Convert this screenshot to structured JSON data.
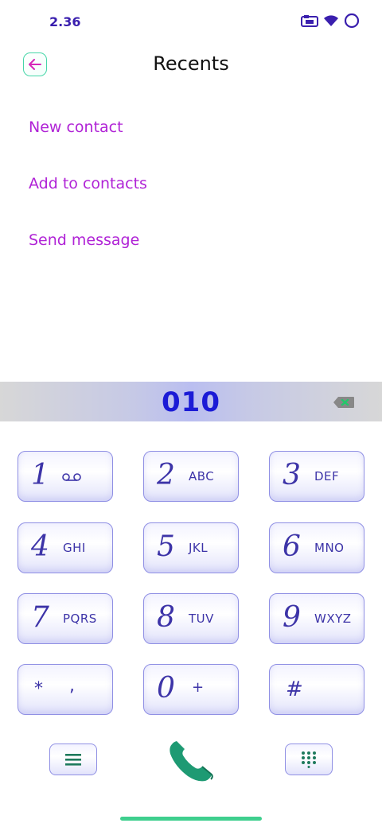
{
  "status": {
    "time": "2.36"
  },
  "header": {
    "title": "Recents"
  },
  "menu": {
    "items": [
      "New contact",
      "Add to contacts",
      "Send message"
    ]
  },
  "number": "010",
  "keypad": {
    "keys": [
      {
        "digit": "1",
        "letters": ""
      },
      {
        "digit": "2",
        "letters": "ABC"
      },
      {
        "digit": "3",
        "letters": "DEF"
      },
      {
        "digit": "4",
        "letters": "GHI"
      },
      {
        "digit": "5",
        "letters": "JKL"
      },
      {
        "digit": "6",
        "letters": "MNO"
      },
      {
        "digit": "7",
        "letters": "PQRS"
      },
      {
        "digit": "8",
        "letters": "TUV"
      },
      {
        "digit": "9",
        "letters": "WXYZ"
      },
      {
        "digit": "*",
        "letters": ","
      },
      {
        "digit": "0",
        "letters": "+"
      },
      {
        "digit": "#",
        "letters": ""
      }
    ]
  },
  "icons": {
    "back": "arrow-left-icon",
    "voicemail": "voicemail-icon",
    "backspace": "backspace-icon",
    "menu": "menu-icon",
    "call": "phone-icon",
    "dialpad": "dialpad-icon"
  },
  "colors": {
    "accent": "#b023d6",
    "digits": "#3d34a8",
    "number": "#1b1bd6",
    "call": "#1e9a73"
  }
}
